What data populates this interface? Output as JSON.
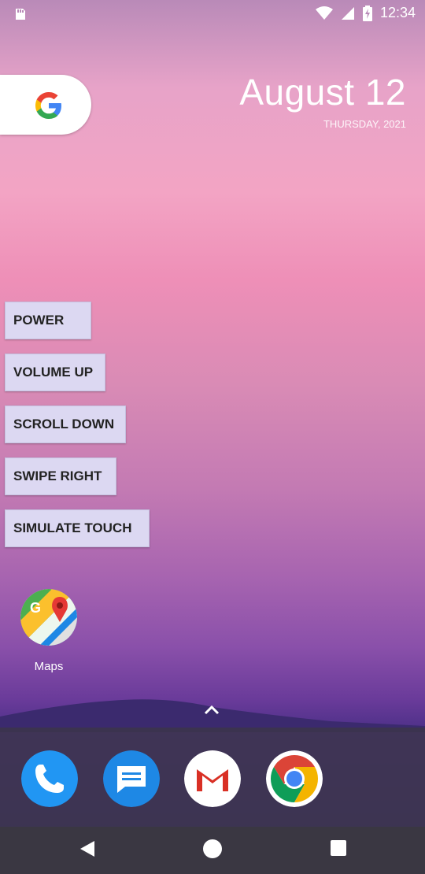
{
  "status_bar": {
    "time": "12:34",
    "icons": [
      "sd-card-icon",
      "wifi-icon",
      "signal-icon",
      "battery-charging-icon"
    ]
  },
  "search_widget": {
    "icon": "google-g-icon"
  },
  "date_widget": {
    "date": "August 12",
    "weekday_year": "THURSDAY, 2021"
  },
  "control_buttons": [
    {
      "label": "POWER"
    },
    {
      "label": "VOLUME UP"
    },
    {
      "label": "SCROLL DOWN"
    },
    {
      "label": "SWIPE RIGHT"
    },
    {
      "label": "SIMULATE TOUCH"
    }
  ],
  "home_apps": [
    {
      "label": "Maps",
      "icon": "maps-icon"
    }
  ],
  "dock": {
    "apps": [
      {
        "icon": "phone-icon",
        "color": "#2196f3"
      },
      {
        "icon": "messages-icon",
        "color": "#1e88e5"
      },
      {
        "icon": "gmail-icon",
        "color": "#ffffff"
      },
      {
        "icon": "chrome-icon",
        "color": "#4285f4"
      }
    ]
  },
  "nav_bar": {
    "icons": [
      "back-icon",
      "home-icon",
      "recents-icon"
    ]
  },
  "colors": {
    "button_bg": "#dcd8f2",
    "dock_bg": "#3c3746",
    "nav_bg": "#3a3742"
  }
}
